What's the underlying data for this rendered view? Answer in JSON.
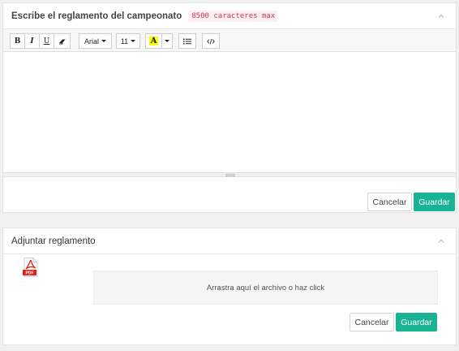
{
  "rules_panel": {
    "title": "Escribe el reglamento del campeonato",
    "limit_badge": "8500 caracteres max",
    "toolbar": {
      "bold": "B",
      "italic": "I",
      "underline": "U",
      "eraser_icon": "eraser-icon",
      "font_family": "Arial",
      "font_size": "11",
      "color_letter": "A",
      "list_icon": "unordered-list-icon",
      "code_icon": "code-view-icon"
    },
    "editor_content": "",
    "cancel_label": "Cancelar",
    "save_label": "Guardar"
  },
  "upload_panel": {
    "title": "Adjuntar reglamento",
    "file_icon": "pdf-file-icon",
    "pdf_label": "PDF",
    "dropzone_text": "Arrastra aquí el archivo o haz click",
    "cancel_label": "Cancelar",
    "save_label": "Guardar"
  },
  "colors": {
    "accent": "#18b394",
    "badge_text": "#d0344f",
    "highlight": "#ffff00",
    "pdf_red": "#d9221c"
  }
}
